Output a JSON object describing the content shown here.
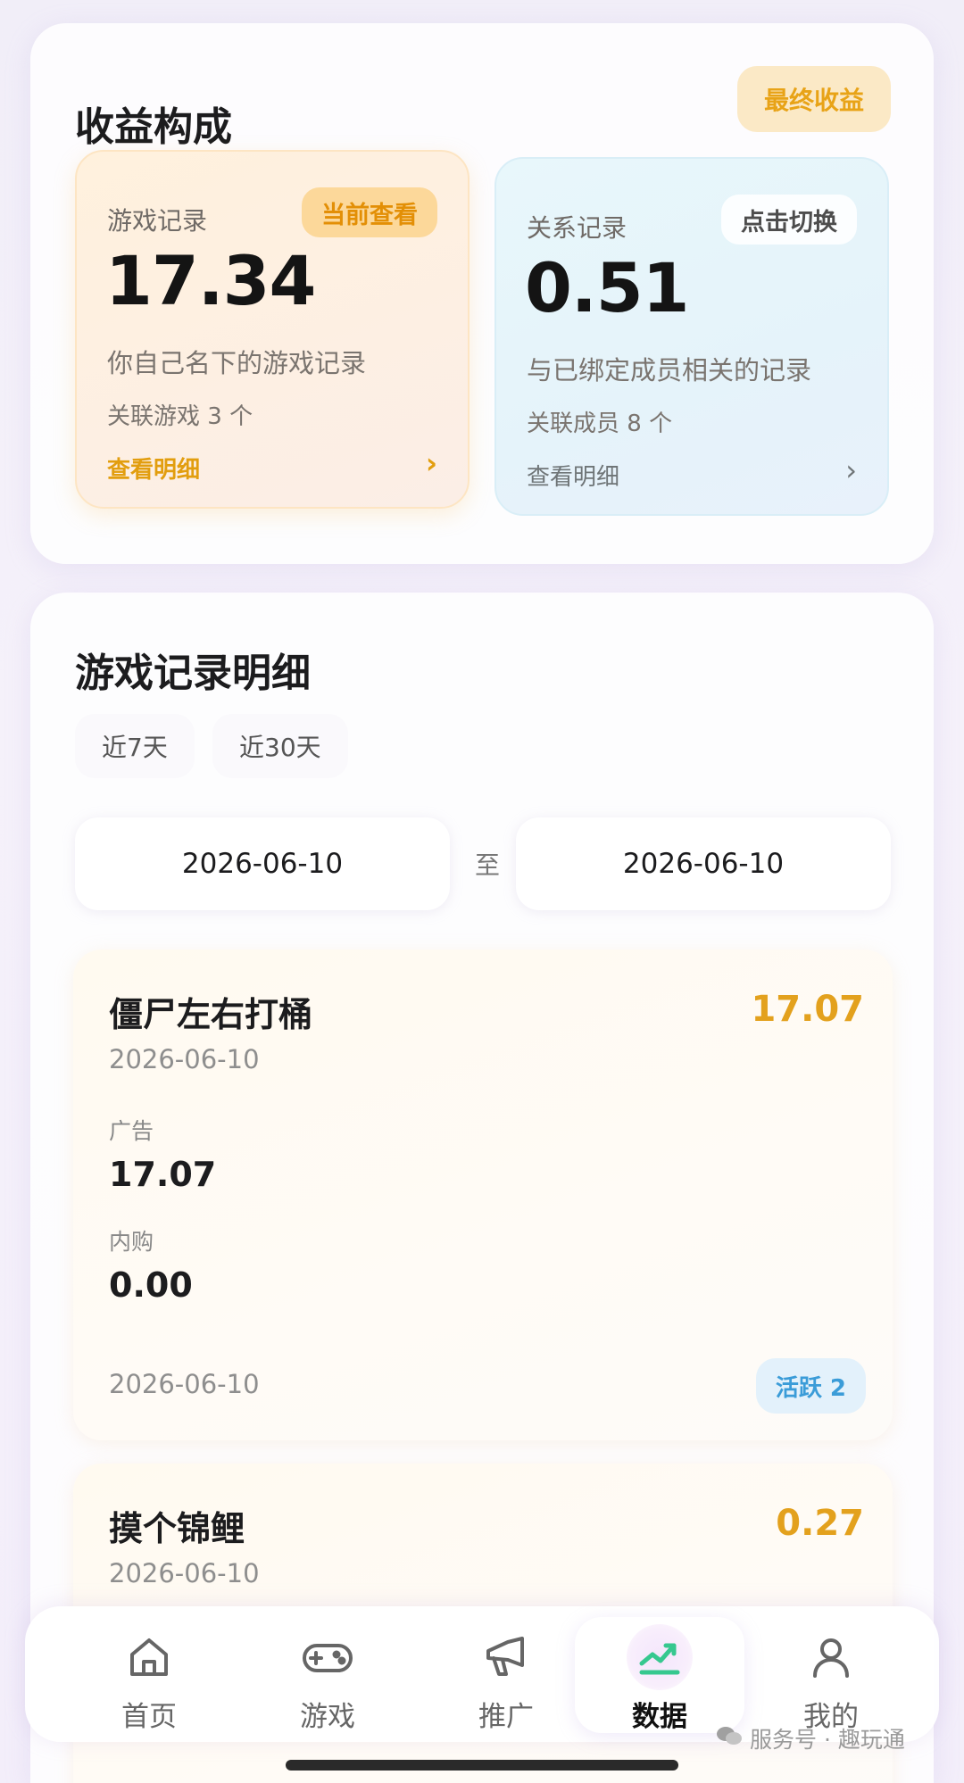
{
  "summary": {
    "title": "收益构成",
    "final_button": "最终收益",
    "game": {
      "label": "游戏记录",
      "pill": "当前查看",
      "value": "17.34",
      "desc": "你自己名下的游戏记录",
      "count": "关联游戏 3 个",
      "link": "查看明细",
      "arrow": "›"
    },
    "relation": {
      "label": "关系记录",
      "pill": "点击切换",
      "value": "0.51",
      "desc": "与已绑定成员相关的记录",
      "count": "关联成员 8 个",
      "link": "查看明细",
      "arrow": "›"
    }
  },
  "detail": {
    "title": "游戏记录明细",
    "tabs": [
      "近7天",
      "近30天"
    ],
    "date_from": "2026-06-10",
    "date_sep": "至",
    "date_to": "2026-06-10",
    "records": [
      {
        "name": "僵尸左右打桶",
        "amount": "17.07",
        "date": "2026-06-10",
        "ad_label": "广告",
        "ad_value": "17.07",
        "iap_label": "内购",
        "iap_value": "0.00",
        "footer_date": "2026-06-10",
        "badge": "活跃 2"
      },
      {
        "name": "摸个锦鲤",
        "amount": "0.27",
        "date": "2026-06-10"
      }
    ]
  },
  "nav": {
    "items": [
      {
        "label": "首页",
        "icon": "home-icon"
      },
      {
        "label": "游戏",
        "icon": "gamepad-icon"
      },
      {
        "label": "推广",
        "icon": "megaphone-icon"
      },
      {
        "label": "数据",
        "icon": "trend-chart-icon",
        "active": true
      },
      {
        "label": "我的",
        "icon": "user-icon"
      }
    ]
  },
  "watermark": "服务号 · 趣玩通",
  "colors": {
    "accent_orange": "#e3a11d",
    "active_green": "#36c88f",
    "badge_blue": "#3b9cd8"
  }
}
